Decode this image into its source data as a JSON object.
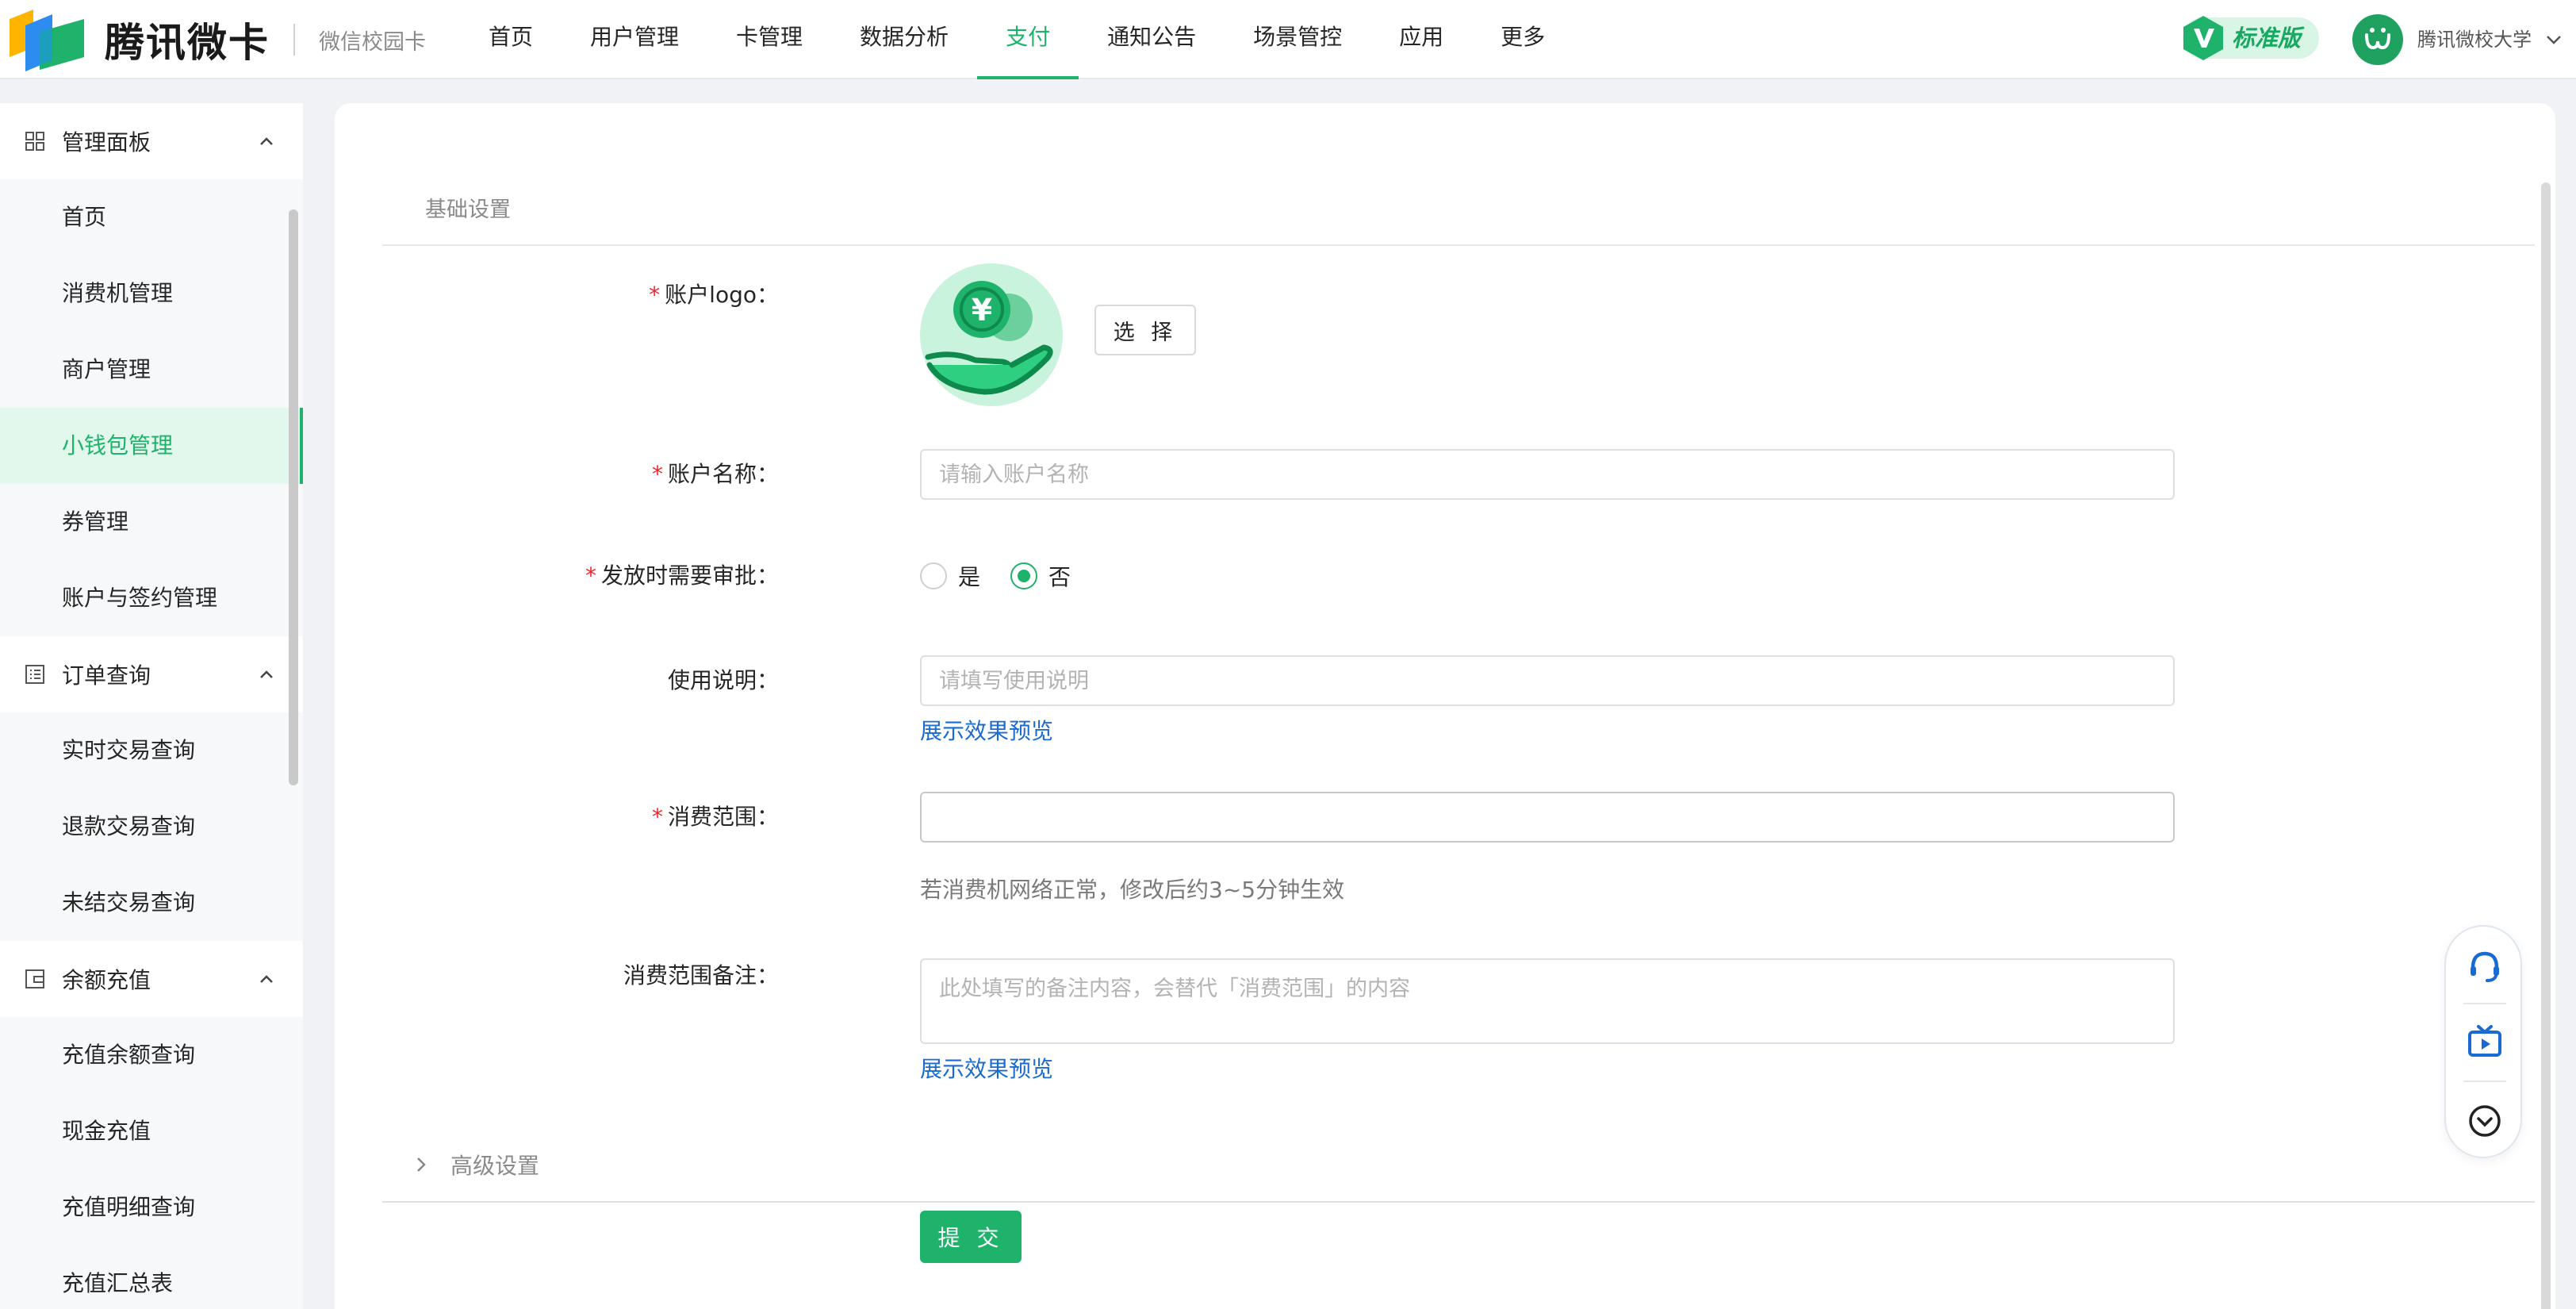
{
  "header": {
    "brand_name": "腾讯微卡",
    "brand_sub": "微信校园卡",
    "nav": [
      "首页",
      "用户管理",
      "卡管理",
      "数据分析",
      "支付",
      "通知公告",
      "场景管控",
      "应用",
      "更多"
    ],
    "active_nav": "支付",
    "edition": "标准版",
    "school": "腾讯微校大学",
    "accent": "#1fb26b"
  },
  "sidebar": {
    "groups": [
      {
        "label": "管理面板",
        "icon": "grid-icon",
        "items": [
          "首页",
          "消费机管理",
          "商户管理",
          "小钱包管理",
          "券管理",
          "账户与签约管理"
        ]
      },
      {
        "label": "订单查询",
        "icon": "list-icon",
        "items": [
          "实时交易查询",
          "退款交易查询",
          "未结交易查询"
        ]
      },
      {
        "label": "余额充值",
        "icon": "wallet-icon",
        "items": [
          "充值余额查询",
          "现金充值",
          "充值明细查询",
          "充值汇总表"
        ]
      }
    ],
    "active_item": "小钱包管理"
  },
  "form": {
    "section_title": "基础设置",
    "logo_label": "账户logo：",
    "choose_label": "选 择",
    "name_label": "账户名称：",
    "name_placeholder": "请输入账户名称",
    "name_value": "",
    "approval_label": "发放时需要审批：",
    "approval_options": [
      "是",
      "否"
    ],
    "approval_selected": "否",
    "usage_label": "使用说明：",
    "usage_placeholder": "请填写使用说明",
    "usage_value": "",
    "preview_link": "展示效果预览",
    "scope_label": "消费范围：",
    "scope_value": "",
    "scope_hint": "若消费机网络正常，修改后约3~5分钟生效",
    "scope_note_label": "消费范围备注：",
    "scope_note_placeholder": "此处填写的备注内容，会替代「消费范围」的内容",
    "advanced_label": "高级设置",
    "submit_label": "提 交",
    "required_mark": "*"
  },
  "float_tools": [
    "headset-icon",
    "video-tv-icon",
    "chevron-down-circle-icon"
  ]
}
